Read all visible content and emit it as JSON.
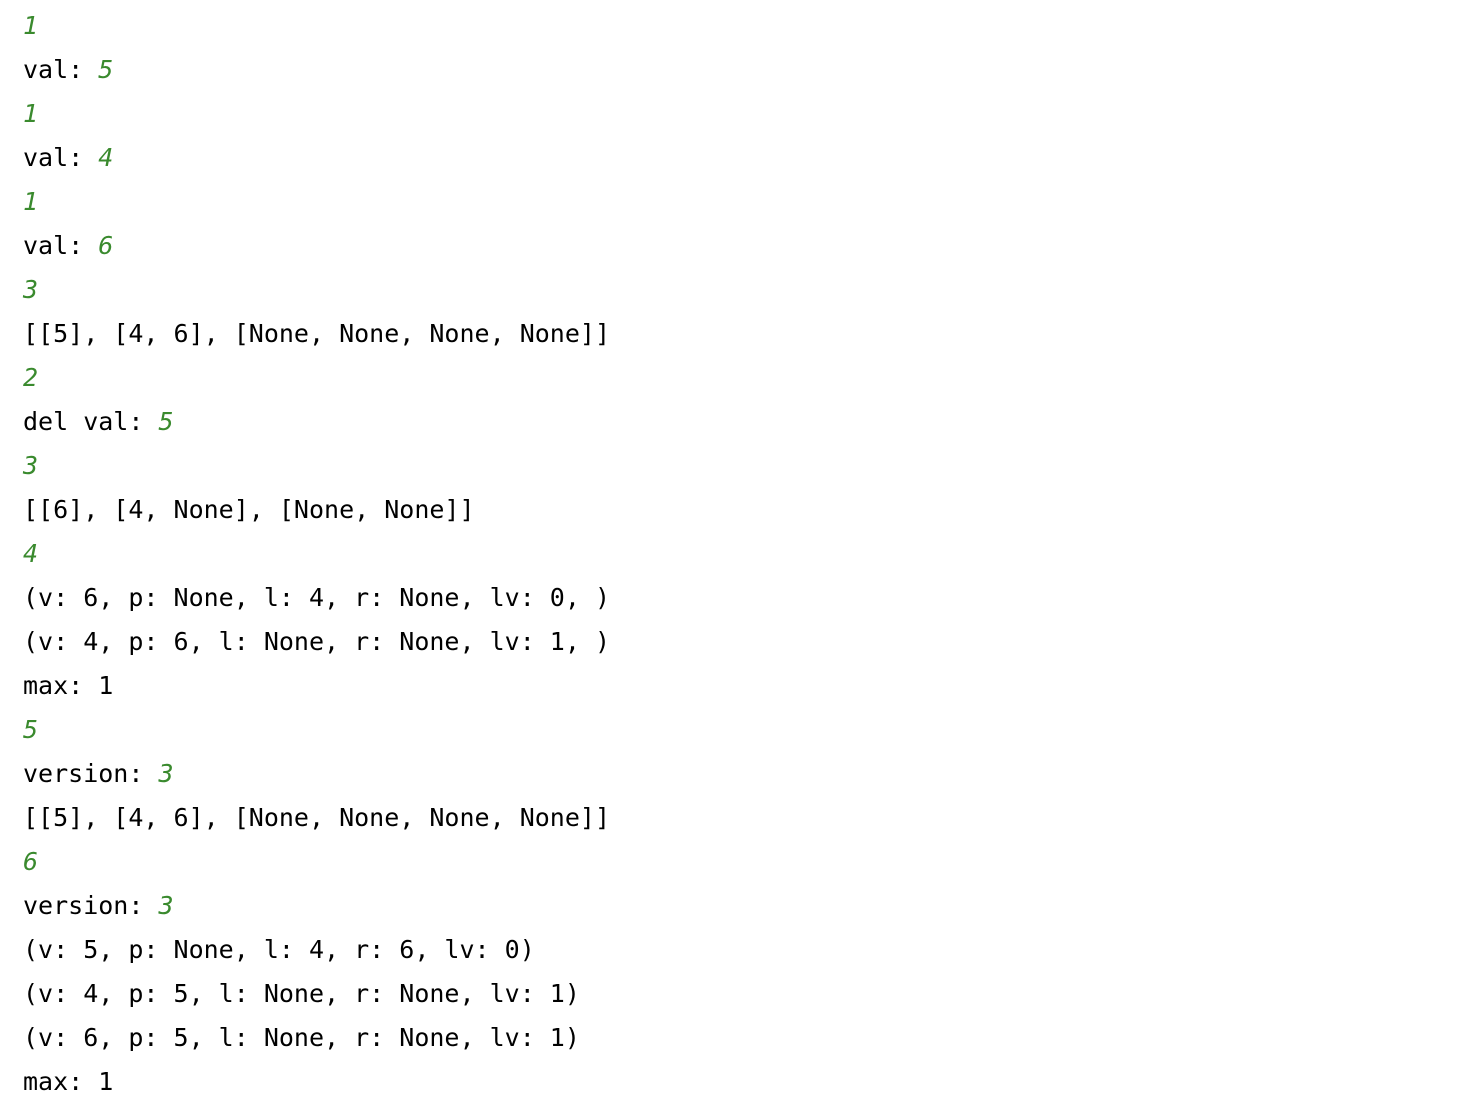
{
  "lines": [
    {
      "text": "",
      "value": "1"
    },
    {
      "text": "val: ",
      "value": "5"
    },
    {
      "text": "",
      "value": "1"
    },
    {
      "text": "val: ",
      "value": "4"
    },
    {
      "text": "",
      "value": "1"
    },
    {
      "text": "val: ",
      "value": "6"
    },
    {
      "text": "",
      "value": "3"
    },
    {
      "text": "[[5], [4, 6], [None, None, None, None]]",
      "value": ""
    },
    {
      "text": "",
      "value": "2"
    },
    {
      "text": "del val: ",
      "value": "5"
    },
    {
      "text": "",
      "value": "3"
    },
    {
      "text": "[[6], [4, None], [None, None]]",
      "value": ""
    },
    {
      "text": "",
      "value": "4"
    },
    {
      "text": "(v: 6, p: None, l: 4, r: None, lv: 0, )",
      "value": ""
    },
    {
      "text": "(v: 4, p: 6, l: None, r: None, lv: 1, )",
      "value": ""
    },
    {
      "text": "max: 1",
      "value": ""
    },
    {
      "text": "",
      "value": "5"
    },
    {
      "text": "version: ",
      "value": "3"
    },
    {
      "text": "[[5], [4, 6], [None, None, None, None]]",
      "value": ""
    },
    {
      "text": "",
      "value": "6"
    },
    {
      "text": "version: ",
      "value": "3"
    },
    {
      "text": "(v: 5, p: None, l: 4, r: 6, lv: 0)",
      "value": ""
    },
    {
      "text": "(v: 4, p: 5, l: None, r: None, lv: 1)",
      "value": ""
    },
    {
      "text": "(v: 6, p: 5, l: None, r: None, lv: 1)",
      "value": ""
    },
    {
      "text": "max: 1",
      "value": ""
    }
  ],
  "colors": {
    "number": "#3a8a2e",
    "text": "#000000",
    "background": "#ffffff"
  }
}
